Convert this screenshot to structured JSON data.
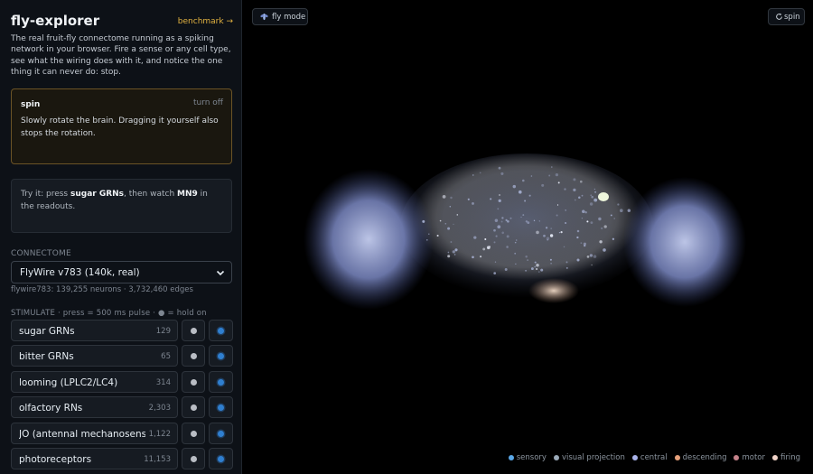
{
  "app": {
    "title": "fly-explorer",
    "benchmark_link": "benchmark →",
    "intro": "The real fruit-fly connectome running as a spiking network in your browser. Fire a sense or any cell type, see what the wiring does with it, and notice the one thing it can never do: stop."
  },
  "mode_card": {
    "name": "spin",
    "action": "turn off",
    "description": "Slowly rotate the brain. Dragging it yourself also stops the rotation."
  },
  "tip": {
    "prefix": "Try it: press ",
    "stimulus": "sugar GRNs",
    "middle": ", then watch ",
    "readout": "MN9",
    "suffix": " in the readouts."
  },
  "connectome": {
    "section_label": "CONNECTOME",
    "selected": "FlyWire v783 (140k, real)",
    "stats": "flywire783: 139,255 neurons · 3,732,460 edges"
  },
  "stimulate": {
    "section_label": "STIMULATE · press = 500 ms pulse · ● = hold on",
    "items": [
      {
        "label": "sugar GRNs",
        "count": "129"
      },
      {
        "label": "bitter GRNs",
        "count": "65"
      },
      {
        "label": "looming (LPLC2/LC4)",
        "count": "314"
      },
      {
        "label": "olfactory RNs",
        "count": "2,303"
      },
      {
        "label": "JO (antennal mechanosensor…",
        "count": "1,122"
      },
      {
        "label": "photoreceptors",
        "count": "11,153"
      }
    ]
  },
  "toolbar": {
    "fly_mode": "fly mode",
    "spin": "spin"
  },
  "legend": [
    {
      "label": "sensory",
      "color": "#5aa7e6"
    },
    {
      "label": "visual projection",
      "color": "#9aa9b8"
    },
    {
      "label": "central",
      "color": "#a9b3ea"
    },
    {
      "label": "descending",
      "color": "#e6a07a"
    },
    {
      "label": "motor",
      "color": "#c5828a"
    },
    {
      "label": "firing",
      "color": "#f1d3c8"
    }
  ],
  "colors": {
    "accent": "#e3b341",
    "hold_dot": "#2f7fd0",
    "brain_optic": "#8f9cd6",
    "brain_central": "#c8cde0"
  }
}
